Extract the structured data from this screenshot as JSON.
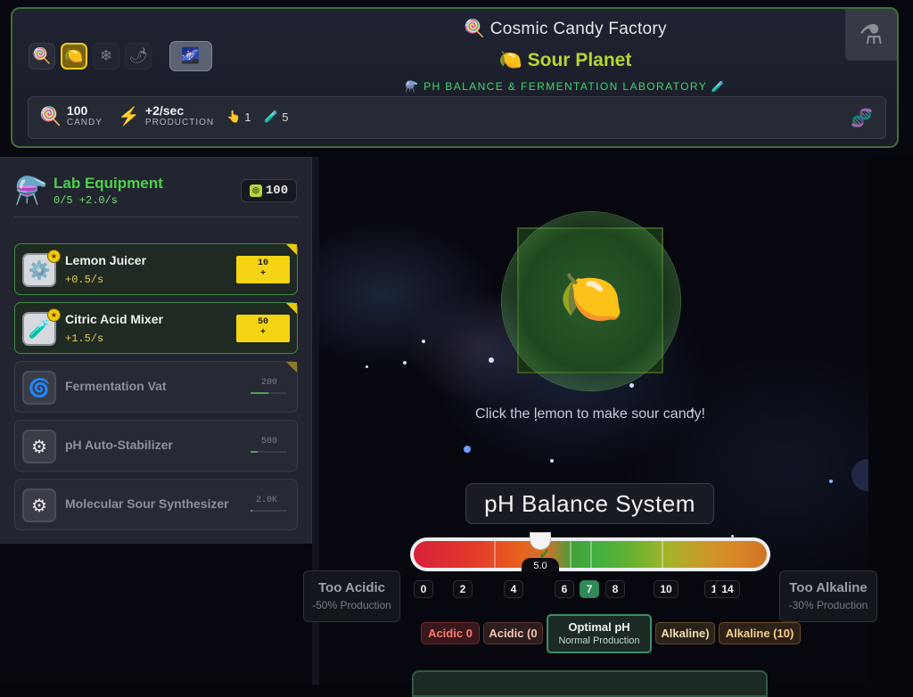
{
  "header": {
    "app_title": "Cosmic Candy Factory",
    "app_icon": "🍭",
    "planet_title": "Sour Planet",
    "planet_icon": "🍋",
    "lab_subtitle": "PH BALANCE & FERMENTATION LABORATORY",
    "planets": [
      {
        "name": "lollipop-planet",
        "icon": "🍭"
      },
      {
        "name": "sour-planet",
        "icon": "🍋"
      },
      {
        "name": "ice-planet",
        "icon": "❄"
      },
      {
        "name": "spicy-planet",
        "icon": "🌶"
      }
    ],
    "galaxy_icon": "🌌",
    "flask_icon": "⚗"
  },
  "stats": {
    "candy_value": "100",
    "candy_label": "CANDY",
    "production_value": "+2/sec",
    "production_label": "PRODUCTION",
    "clicks": "1",
    "tests": "5",
    "candy_icon": "🍭",
    "production_icon": "⚡",
    "click_icon": "👆",
    "tube_icon": "🧪",
    "dna_icon": "🧬"
  },
  "lab": {
    "title": "Lab Equipment",
    "subtitle": "0/5 +2.0/s",
    "coins": "100",
    "icon": "⚗️",
    "items": [
      {
        "name": "Lemon Juicer",
        "rate": "+0.5/s",
        "cost": "10",
        "buy": "+",
        "icon": "⚙️",
        "owned": true
      },
      {
        "name": "Citric Acid Mixer",
        "rate": "+1.5/s",
        "cost": "50",
        "buy": "+",
        "icon": "🧪",
        "owned": true
      },
      {
        "name": "Fermentation Vat",
        "cost": "200",
        "icon": "🌀",
        "progress": 0.5,
        "owned": false
      },
      {
        "name": "pH Auto-Stabilizer",
        "cost": "500",
        "icon": "⚙",
        "progress": 0.2,
        "owned": false
      },
      {
        "name": "Molecular Sour Synthesizer",
        "cost": "2.0K",
        "icon": "⚙",
        "progress": 0.05,
        "owned": false
      }
    ]
  },
  "clicker": {
    "hint": "Click the lemon to make sour candy!",
    "icon": "🍋"
  },
  "ph": {
    "title": "pH Balance System",
    "current_value": "5.0",
    "ticks": [
      "0",
      "2",
      "4",
      "6",
      "7",
      "8",
      "10",
      "1",
      "14"
    ],
    "active_tick": "7",
    "too_acidic": {
      "title": "Too Acidic",
      "sub": "-50% Production"
    },
    "too_alkaline": {
      "title": "Too Alkaline",
      "sub": "-30% Production"
    },
    "zones": {
      "acidic_0": "Acidic 0",
      "acidic_0b": "Acidic (0",
      "optimal_title": "Optimal pH",
      "optimal_sub": "Normal Production",
      "alkaline": "Alkaline)",
      "alkaline_10": "Alkaline (10)"
    }
  }
}
